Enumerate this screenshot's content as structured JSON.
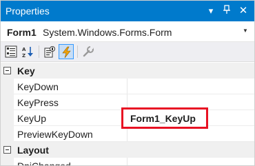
{
  "window": {
    "title": "Properties",
    "dropdown_icon": "▾",
    "pin_icon": "⊥",
    "close_icon": "✕"
  },
  "object_selector": {
    "name": "Form1",
    "type": "System.Windows.Forms.Form"
  },
  "toolbar": {
    "buttons": [
      "categorized-icon",
      "alphabetical-icon",
      "properties-icon",
      "events-icon",
      "property-pages-icon"
    ],
    "selected": "events-icon"
  },
  "grid": {
    "categories": [
      {
        "label": "Key",
        "rows": [
          {
            "name": "KeyDown",
            "value": ""
          },
          {
            "name": "KeyPress",
            "value": ""
          },
          {
            "name": "KeyUp",
            "value": "Form1_KeyUp"
          },
          {
            "name": "PreviewKeyDown",
            "value": ""
          }
        ]
      },
      {
        "label": "Layout",
        "rows": [
          {
            "name": "DpiChanged",
            "value": ""
          }
        ]
      }
    ]
  },
  "colors": {
    "titlebar": "#007acc",
    "highlight": "#e81123"
  }
}
